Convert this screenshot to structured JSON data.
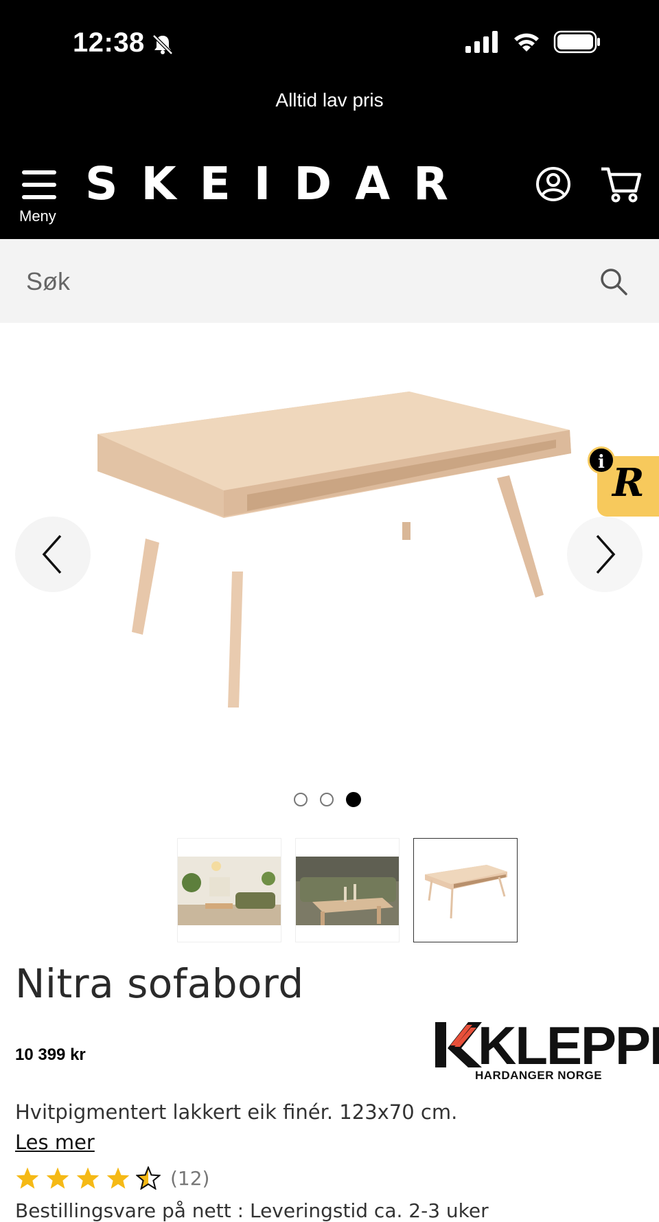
{
  "status_bar": {
    "time": "12:38"
  },
  "promo": {
    "text": "Alltid lav pris"
  },
  "header": {
    "menu_label": "Meny",
    "logo": "SKEIDAR"
  },
  "search": {
    "placeholder": "Søk"
  },
  "carousel": {
    "slide_count": 3,
    "active_index": 2
  },
  "rating_badge": {
    "info": "i",
    "letter": "R"
  },
  "product": {
    "title": "Nitra sofabord",
    "price": "10 399 kr",
    "brand": {
      "name": "KLEPPE",
      "tagline": "HARDANGER NORGE",
      "accent": "#e8503a"
    },
    "description": "Hvitpigmentert lakkert eik finér. 123x70 cm.",
    "read_more": "Les mer",
    "rating": 4.5,
    "review_count": "(12)",
    "delivery": "Bestillingsvare på nett : Leveringstid ca. 2-3 uker"
  },
  "colors": {
    "header_bg": "#000000",
    "search_bg": "#f3f3f3",
    "star": "#f5b915",
    "badge": "#f7c95c"
  }
}
